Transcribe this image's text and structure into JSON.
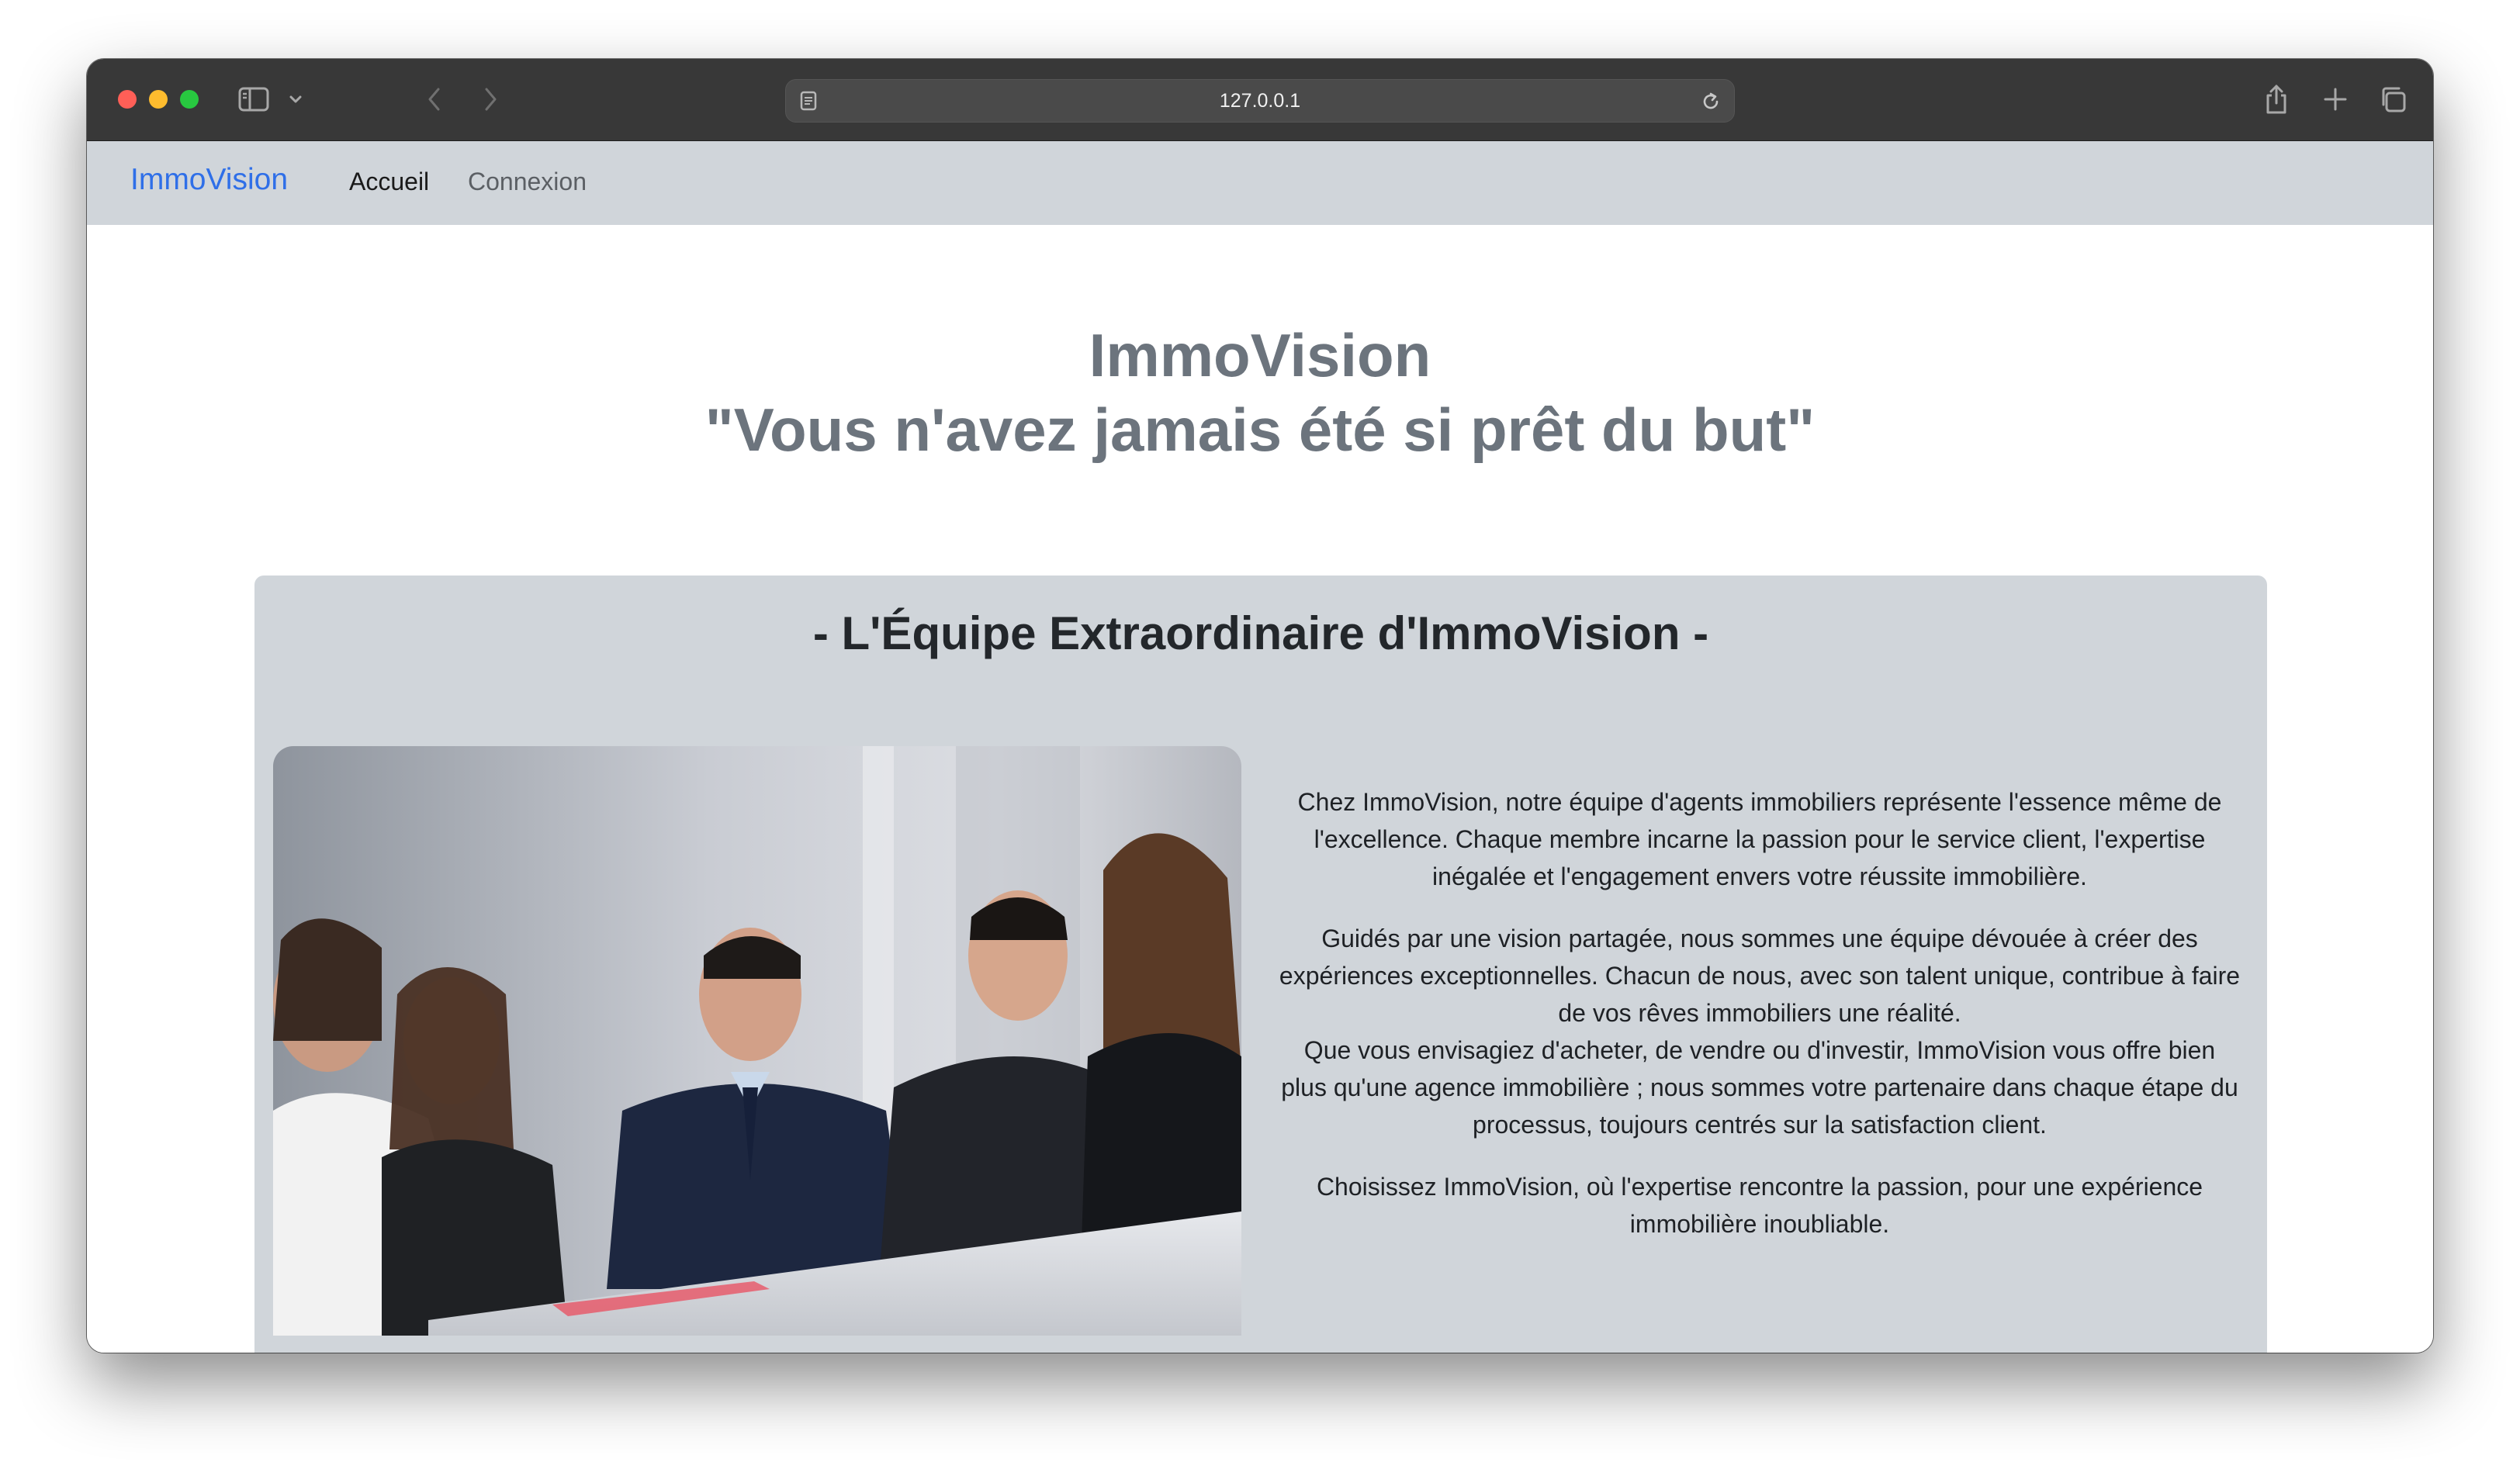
{
  "browser": {
    "url": "127.0.0.1"
  },
  "navbar": {
    "brand": "ImmoVision",
    "links": [
      "Accueil",
      "Connexion"
    ]
  },
  "hero": {
    "title": "ImmoVision",
    "slogan": "\"Vous n'avez jamais été si prêt du but\""
  },
  "team": {
    "heading": "- L'Équipe Extraordinaire d'ImmoVision -",
    "paragraphs": [
      "Chez ImmoVision, notre équipe d'agents immobiliers représente l'essence même de l'excellence. Chaque membre incarne la passion pour le service client, l'expertise inégalée et l'engagement envers votre réussite immobilière.",
      "Guidés par une vision partagée, nous sommes une équipe dévouée à créer des expériences exceptionnelles. Chacun de nous, avec son talent unique, contribue à faire de vos rêves immobiliers une réalité.",
      "Que vous envisagiez d'acheter, de vendre ou d'investir, ImmoVision vous offre bien plus qu'une agence immobilière ; nous sommes votre partenaire dans chaque étape du processus, toujours centrés sur la satisfaction client.",
      "Choisissez ImmoVision, où l'expertise rencontre la passion, pour une expérience immobilière inoubliable."
    ]
  },
  "colors": {
    "brand": "#2f6fe8",
    "navbar_bg": "#d0d5da",
    "hero_text": "#6c747d",
    "card_bg": "#d0d5da"
  },
  "icons": [
    "sidebar-icon",
    "chevron-down-icon",
    "back-icon",
    "forward-icon",
    "page-icon",
    "reload-icon",
    "share-icon",
    "plus-icon",
    "tabs-icon"
  ]
}
